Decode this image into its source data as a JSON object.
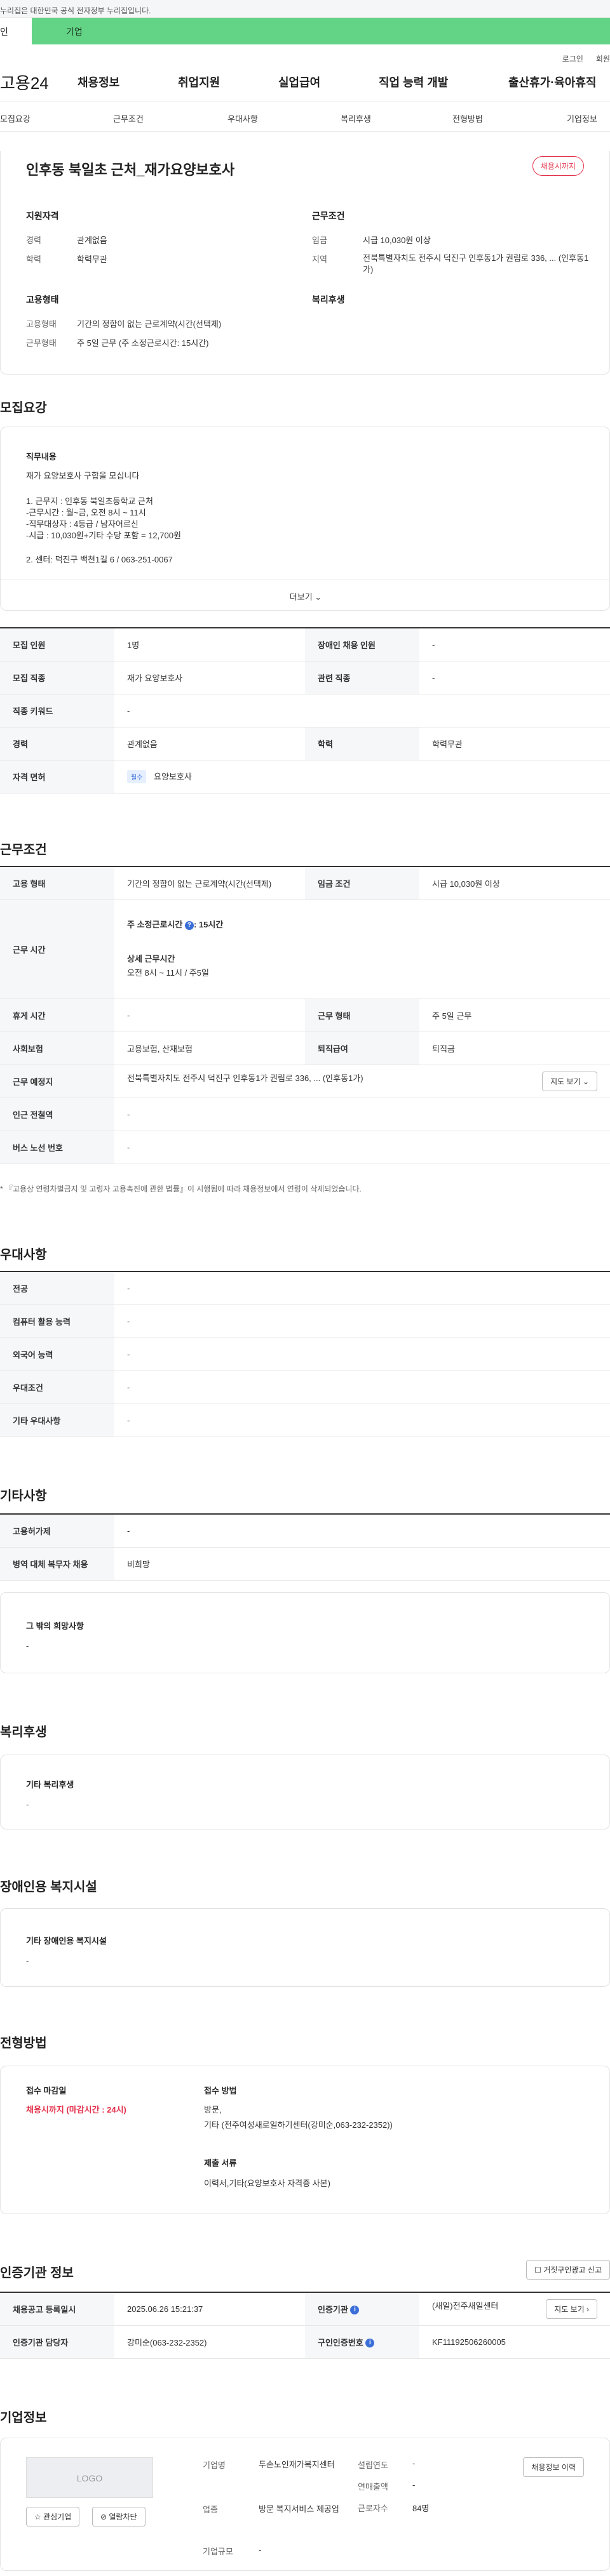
{
  "banner": {
    "text": "누리집은 대한민국 공식 전자정부 누리집입니다."
  },
  "tabs": {
    "tab1": "인",
    "tab2": "기업"
  },
  "util": {
    "login": "로그인",
    "join": "회원"
  },
  "gnb": {
    "logo": "고용24",
    "menu": [
      "채용정보",
      "취업지원",
      "실업급여",
      "직업 능력 개발",
      "출산휴가·육아휴직"
    ]
  },
  "anchor_nav": [
    "모집요강",
    "근무조건",
    "우대사항",
    "복리후생",
    "전형방법",
    "기업정보"
  ],
  "summary": {
    "title": "인후동 북일초 근처_재가요양보호사",
    "badge": "채용시까지",
    "qual_title": "지원자격",
    "cond_title": "근무조건",
    "exp_label": "경력",
    "exp_value": "관계없음",
    "edu_label": "학력",
    "edu_value": "학력무관",
    "wage_label": "임금",
    "wage_value": "시급 10,030원 이상",
    "area_label": "지역",
    "area_value": "전북특별자치도 전주시 덕진구 인후동1가 권림로 336, ... (인후동1가)",
    "emp_title": "고용형태",
    "welfare_title": "복리후생",
    "emptype_label": "고용형태",
    "emptype_value": "기간의 정함이 없는 근로계약(시간(선택제)",
    "worktype_label": "근무형태",
    "worktype_value": "주 5일 근무 (주 소정근로시간: 15시간)"
  },
  "recruit": {
    "section_title": "모집요강",
    "duty_title": "직무내용",
    "duty_lines": [
      "재가 요양보호사 구합을 모십니다",
      "1. 근무지 : 인후동 북일초등학교 근처",
      "-근무시간 : 월~금, 오전 8시 ~ 11시",
      "-직무대상자 : 4등급 / 남자어르신",
      "-시급 : 10,030원+기타 수당 포함 = 12,700원",
      "2. 센터: 덕진구 백천1길 6 / 063-251-0067"
    ],
    "more_label": "더보기 ⌄",
    "rows": [
      {
        "l1": "모집 인원",
        "v1": "1명",
        "l2": "장애인 채용 인원",
        "v2": "-"
      },
      {
        "l1": "모집 직종",
        "v1": "재가 요양보호사",
        "l2": "관련 직종",
        "v2": "-"
      },
      {
        "l1": "직종 키워드",
        "v1": "-"
      },
      {
        "l1": "경력",
        "v1": "관계없음",
        "l2": "학력",
        "v2": "학력무관"
      },
      {
        "l1": "자격 면허",
        "badge": "필수",
        "v1": "요양보호사"
      }
    ]
  },
  "conditions": {
    "section_title": "근무조건",
    "emp_type_label": "고용 형태",
    "emp_type_value": "기간의 정함이 없는 근로계약(시간(선택제)",
    "wage_label": "임금 조건",
    "wage_value": "시급 10,030원 이상",
    "worktime_label": "근무 시간",
    "weekly_hours_label": "주 소정근로시간",
    "weekly_hours_value": ": 15시간",
    "detail_label": "상세 근무시간",
    "detail_value": "오전 8시 ~ 11시 / 주5일",
    "holiday_label": "휴게 시간",
    "holiday_value": "-",
    "workform_label": "근무 형태",
    "workform_value": "주 5일 근무",
    "insurance_label": "사회보험",
    "insurance_value": "고용보험, 산재보험",
    "severance_label": "퇴직급여",
    "severance_value": "퇴직금",
    "location_label": "근무 예정지",
    "location_value": "전북특별자치도 전주시 덕진구 인후동1가 권림로 336, ... (인후동1가)",
    "map_button": "지도 보기 ⌄",
    "subway_label": "인근 전철역",
    "subway_value": "-",
    "bus_label": "버스 노선 번호",
    "bus_value": "-",
    "note": "* 『고용상 연령차별금지 및 고령자 고용촉진에 관한 법률』이 시행됨에 따라 채용정보에서 연령이 삭제되었습니다."
  },
  "preference": {
    "section_title": "우대사항",
    "rows": [
      {
        "label": "전공",
        "value": "-"
      },
      {
        "label": "컴퓨터 활용 능력",
        "value": "-"
      },
      {
        "label": "외국어 능력",
        "value": "-"
      },
      {
        "label": "우대조건",
        "value": "-"
      },
      {
        "label": "기타 우대사항",
        "value": "-"
      }
    ]
  },
  "etc": {
    "section_title": "기타사항",
    "rows": [
      {
        "label": "고용허가제",
        "value": "-"
      },
      {
        "label": "병역 대체 복무자 채용",
        "value": "비희망"
      }
    ],
    "other_title": "그 밖의 희망사항",
    "other_value": "-"
  },
  "welfare": {
    "section_title": "복리후생",
    "box_title": "기타 복리후생",
    "box_value": "-"
  },
  "disability": {
    "section_title": "장애인용 복지시설",
    "box_title": "기타 장애인용 복지시설",
    "box_value": "-"
  },
  "selection": {
    "section_title": "전형방법",
    "deadline_title": "접수 마감일",
    "deadline_value": "채용시까지 (마감시간 : 24시)",
    "method_title": "접수 방법",
    "method_lines": [
      "방문,",
      "기타 (전주여성새로일하기센터(강미순,063-232-2352))"
    ],
    "docs_title": "제출 서류",
    "docs_value": "이력서,기타(요양보호사 자격증 사본)"
  },
  "agency": {
    "section_title": "인증기관 정보",
    "report_button": "거짓구인광고 신고",
    "reg_date_label": "채용공고 등록일시",
    "reg_date_value": "2025.06.26 15:21:37",
    "agency_label": "인증기관",
    "agency_value": "(새일)전주새일센터",
    "map_button": "지도 보기 ›",
    "manager_label": "인증기관 담당자",
    "manager_value": "강미순(063-232-2352)",
    "post_no_label": "구인인증번호",
    "post_no_value": "KF11192506260005"
  },
  "company": {
    "section_title": "기업정보",
    "logo_text": "LOGO",
    "interest_button": "관심기업",
    "block_button": "열람차단",
    "info_button": "채용정보 이력",
    "name_label": "기업명",
    "name_value": "두손노인재가복지센터",
    "industry_label": "업종",
    "industry_value": "방문 복지서비스 제공업",
    "scale_label": "기업규모",
    "scale_value": "-",
    "founded_label": "설립연도",
    "founded_value": "-",
    "sales_label": "연매출액",
    "sales_value": "-",
    "employees_label": "근로자수",
    "employees_value": "84명"
  },
  "colors": {
    "accent_green": "#63d486",
    "alert_red": "#e3304a",
    "info_blue": "#3b6fd8"
  }
}
